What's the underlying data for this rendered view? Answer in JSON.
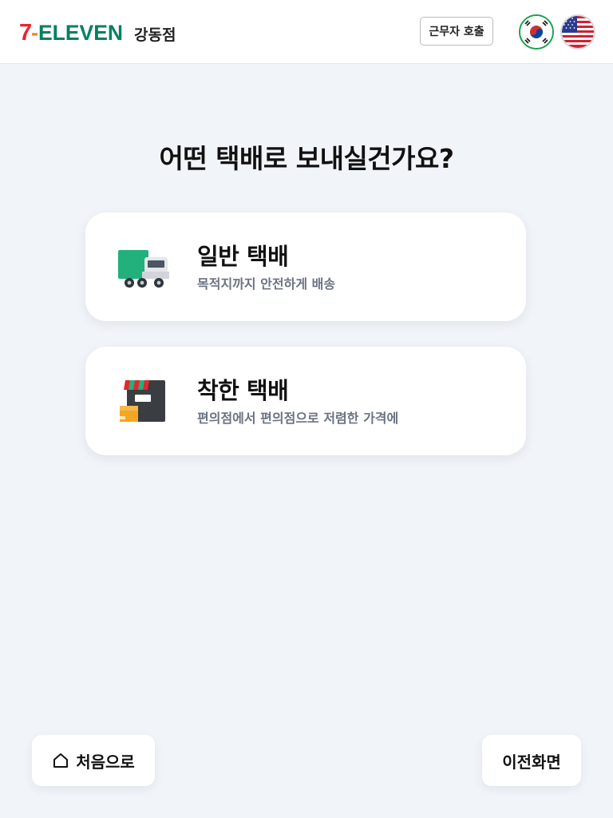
{
  "header": {
    "brand": "7-ELEVEN",
    "store_name": "강동점",
    "call_staff_label": "근무자 호출",
    "languages": [
      {
        "code": "ko",
        "icon": "korea-flag-icon",
        "selected": true
      },
      {
        "code": "en",
        "icon": "usa-flag-icon",
        "selected": false
      }
    ]
  },
  "main": {
    "title": "어떤 택배로 보내실건가요?",
    "options": [
      {
        "title": "일반 택배",
        "description": "목적지까지 안전하게 배송",
        "icon": "delivery-truck-icon"
      },
      {
        "title": "착한 택배",
        "description": "편의점에서 편의점으로 저렴한 가격에",
        "icon": "convenience-store-icon"
      }
    ]
  },
  "footer": {
    "home_label": "처음으로",
    "home_icon": "home-icon",
    "back_label": "이전화면"
  },
  "colors": {
    "background": "#f1f5f9",
    "accent_green": "#16a34a",
    "brand_red": "#e5262d",
    "brand_orange": "#f58220",
    "brand_green": "#00825f"
  }
}
